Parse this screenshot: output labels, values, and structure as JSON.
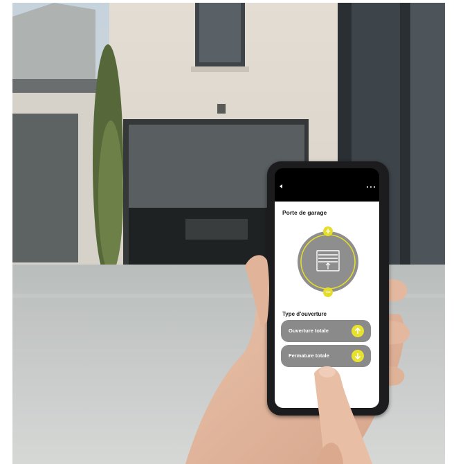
{
  "app": {
    "title": "Porte de garage",
    "back_icon": "chevron-left-icon",
    "more_icon": "more-horizontal-icon"
  },
  "dial": {
    "increase_icon": "plus-icon",
    "decrease_icon": "minus-icon",
    "center_icon": "garage-door-open-icon",
    "plus_glyph": "+",
    "minus_glyph": "−"
  },
  "opening": {
    "section_title": "Type d'ouverture",
    "open_label": "Ouverture totale",
    "open_icon": "arrow-up-icon",
    "close_label": "Fermature totale",
    "close_icon": "arrow-down-icon"
  },
  "colors": {
    "accent": "#e4dd2a",
    "button_bg": "#8a8a8a",
    "dial_bg": "#8e8e8e"
  }
}
